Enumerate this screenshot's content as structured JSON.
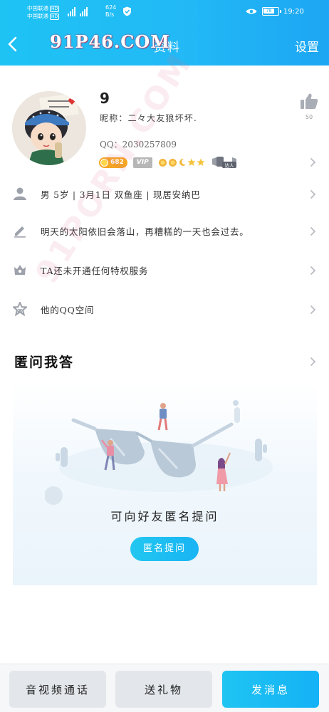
{
  "status_bar": {
    "carrier1": "中国联通",
    "carrier2": "中国联通",
    "hd": "HD",
    "net_speed": "624",
    "net_unit": "B/s",
    "battery": "78",
    "time": "19:20"
  },
  "header": {
    "title": "资料",
    "watermark": "91P46.COM",
    "settings_label": "设置"
  },
  "profile": {
    "display_name": "9",
    "nickname_line": "昵称：二々大友狼坏坏.",
    "qq_line": "QQ：2030257809",
    "level": "682",
    "vip": "VIP",
    "talent_label": "达人",
    "like_count": "50"
  },
  "rows": [
    {
      "icon": "person-icon",
      "text": "男  5岁  |  3月1日  双鱼座  |  现居安纳巴"
    },
    {
      "icon": "pencil-icon",
      "text": "明天的太阳依旧会落山，再糟糕的一天也会过去。"
    },
    {
      "icon": "crown-icon",
      "text": "TA还未开通任何特权服务"
    },
    {
      "icon": "star-icon",
      "text": "他的QQ空间"
    }
  ],
  "qa": {
    "title": "匿问我答",
    "prompt": "可向好友匿名提问",
    "ask_button": "匿名提问"
  },
  "bottom_bar": {
    "call_label": "音视频通话",
    "gift_label": "送礼物",
    "message_label": "发消息"
  },
  "diag_watermark": "91PORN.COM",
  "colors": {
    "accent": "#1db8f5",
    "level_badge": "#f5a623",
    "vip_badge": "#b7b7b7"
  }
}
